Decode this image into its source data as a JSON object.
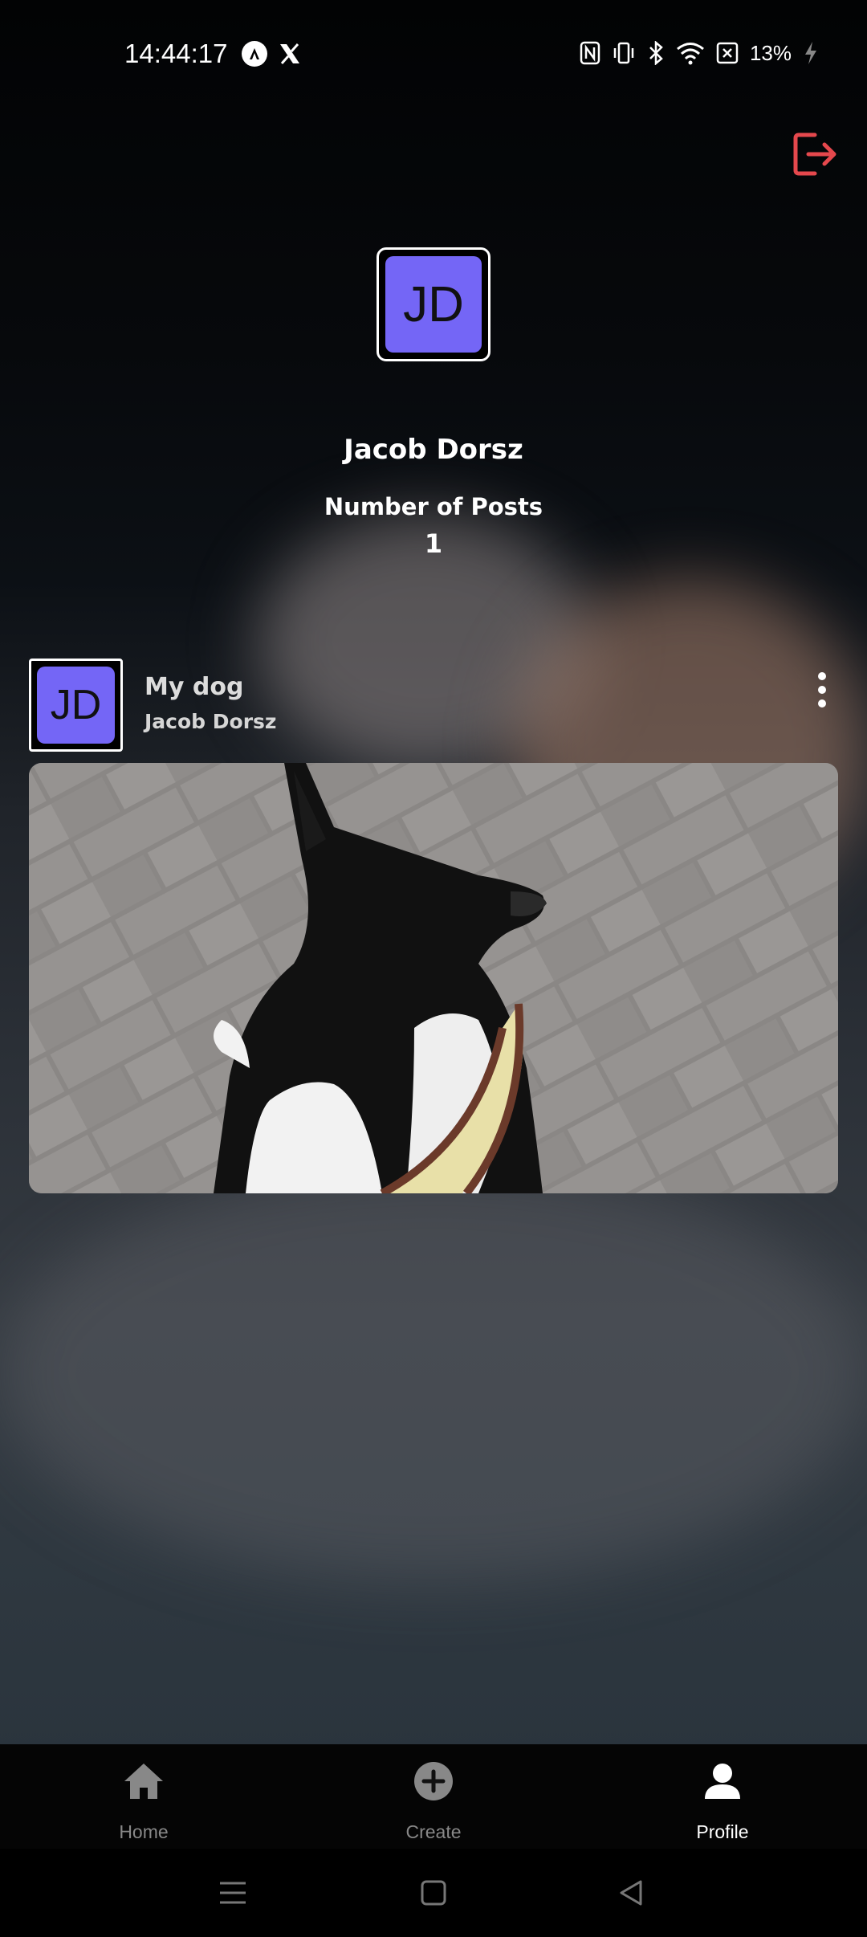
{
  "status_bar": {
    "time": "14:44:17",
    "battery": "13%"
  },
  "profile": {
    "avatar_initials": "JD",
    "name": "Jacob Dorsz",
    "posts_label": "Number of Posts",
    "posts_count": "1"
  },
  "post": {
    "avatar_initials": "JD",
    "title": "My dog",
    "author": "Jacob Dorsz"
  },
  "bottom_nav": {
    "items": [
      {
        "label": "Home",
        "icon": "home-icon",
        "active": false
      },
      {
        "label": "Create",
        "icon": "plus-circle-icon",
        "active": false
      },
      {
        "label": "Profile",
        "icon": "person-icon",
        "active": true
      }
    ]
  },
  "colors": {
    "accent": "#7466f6",
    "logout": "#e5484d",
    "nav_inactive": "#888888",
    "nav_active": "#ffffff"
  }
}
